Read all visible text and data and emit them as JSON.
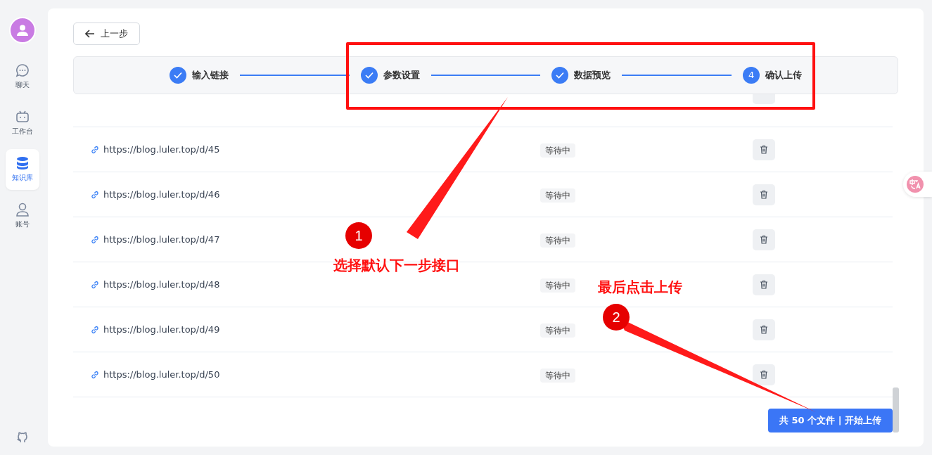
{
  "sidebar": {
    "items": [
      {
        "label": "聊天",
        "selected": false
      },
      {
        "label": "工作台",
        "selected": false
      },
      {
        "label": "知识库",
        "selected": true
      },
      {
        "label": "账号",
        "selected": false
      }
    ]
  },
  "back_button": {
    "label": "上一步"
  },
  "steps": [
    {
      "label": "输入链接",
      "done": true
    },
    {
      "label": "参数设置",
      "done": true
    },
    {
      "label": "数据预览",
      "done": true
    },
    {
      "label": "确认上传",
      "done": false,
      "number": "4"
    }
  ],
  "rows": [
    {
      "url": "https://blog.luler.top/d/45",
      "status": "等待中"
    },
    {
      "url": "https://blog.luler.top/d/46",
      "status": "等待中"
    },
    {
      "url": "https://blog.luler.top/d/47",
      "status": "等待中"
    },
    {
      "url": "https://blog.luler.top/d/48",
      "status": "等待中"
    },
    {
      "url": "https://blog.luler.top/d/49",
      "status": "等待中"
    },
    {
      "url": "https://blog.luler.top/d/50",
      "status": "等待中"
    }
  ],
  "upload_button": {
    "label": "共 50 个文件 | 开始上传"
  },
  "annotations": [
    {
      "number": "1",
      "text": "选择默认下一步接口"
    },
    {
      "number": "2",
      "text": "最后点击上传"
    }
  ]
}
